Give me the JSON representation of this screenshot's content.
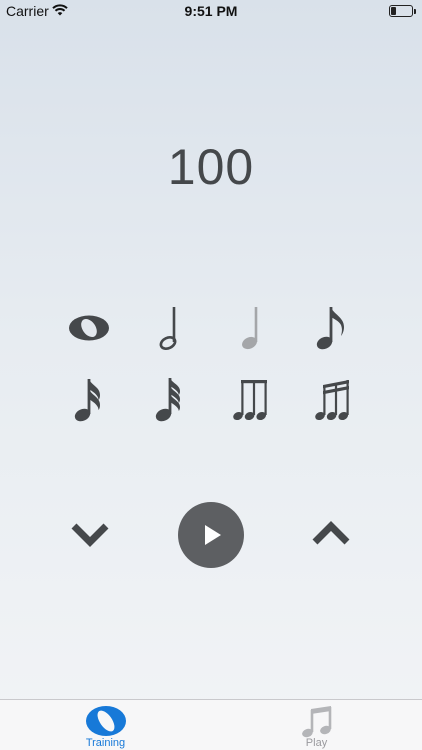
{
  "status_bar": {
    "carrier": "Carrier",
    "time": "9:51 PM"
  },
  "tempo": {
    "bpm": "100"
  },
  "notes": [
    {
      "icon": "whole-note-icon",
      "state": "normal"
    },
    {
      "icon": "half-note-icon",
      "state": "normal"
    },
    {
      "icon": "quarter-note-icon",
      "state": "disabled"
    },
    {
      "icon": "eighth-note-icon",
      "state": "normal"
    },
    {
      "icon": "sixteenth-note-icon",
      "state": "normal"
    },
    {
      "icon": "thirty-second-note-icon",
      "state": "normal"
    },
    {
      "icon": "eighth-triplet-icon",
      "state": "normal"
    },
    {
      "icon": "sixteenth-triplet-icon",
      "state": "normal"
    }
  ],
  "controls": {
    "decrease_icon": "chevron-down-icon",
    "play_icon": "play-icon",
    "increase_icon": "chevron-up-icon"
  },
  "tab_bar": {
    "tabs": [
      {
        "label": "Training",
        "icon": "training-icon",
        "selected": true
      },
      {
        "label": "Play",
        "icon": "music-note-icon",
        "selected": false
      }
    ]
  },
  "colors": {
    "accent": "#1779d8",
    "icon": "#45484b",
    "disabled_icon": "#a4a6a9",
    "play_button": "#5d5f62"
  }
}
